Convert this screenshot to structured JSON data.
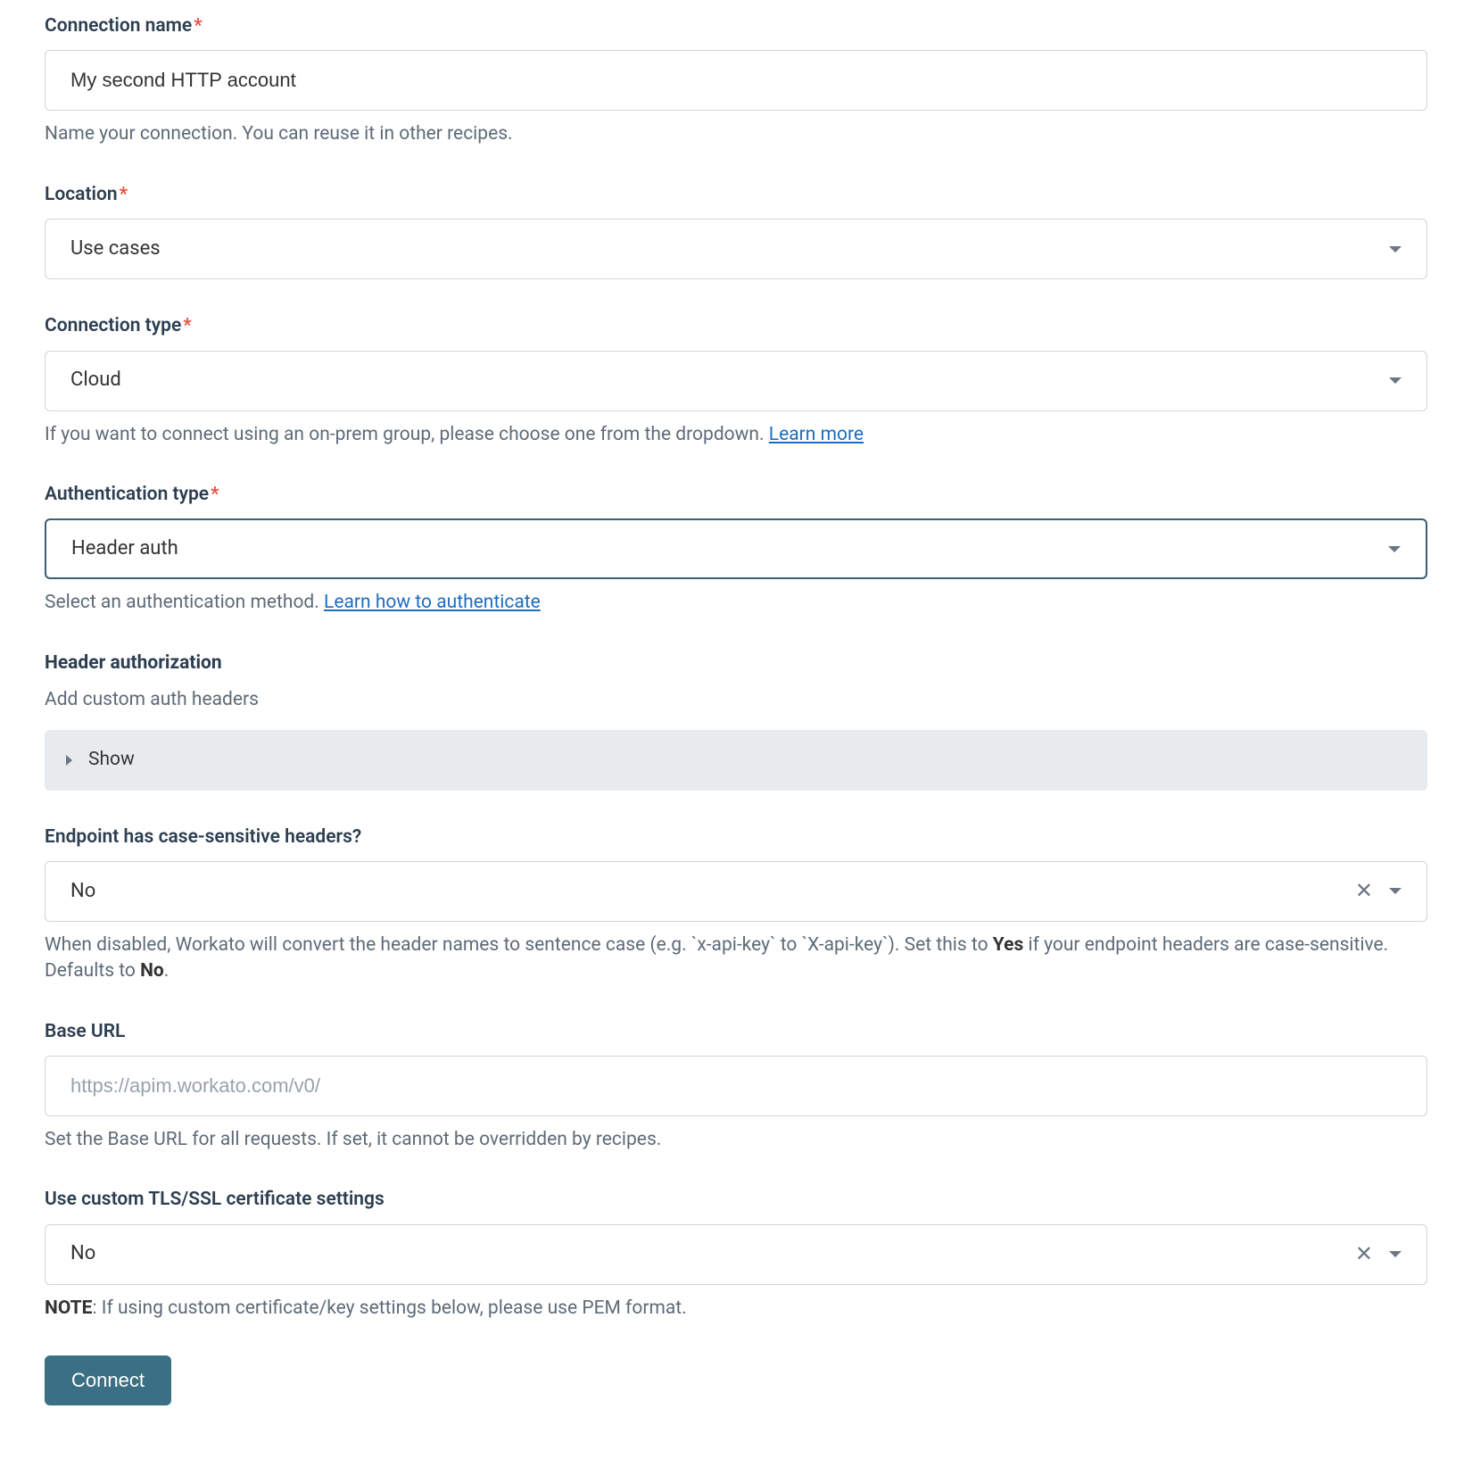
{
  "connectionName": {
    "label": "Connection name",
    "value": "My second HTTP account",
    "help": "Name your connection. You can reuse it in other recipes."
  },
  "location": {
    "label": "Location",
    "value": "Use cases"
  },
  "connectionType": {
    "label": "Connection type",
    "value": "Cloud",
    "helpPrefix": "If you want to connect using an on-prem group, please choose one from the dropdown. ",
    "learnMore": "Learn more"
  },
  "authType": {
    "label": "Authentication type",
    "value": "Header auth",
    "helpPrefix": "Select an authentication method. ",
    "learnLink": "Learn how to authenticate"
  },
  "headerAuth": {
    "title": "Header authorization",
    "subtitle": "Add custom auth headers",
    "showLabel": "Show"
  },
  "caseSensitive": {
    "label": "Endpoint has case-sensitive headers?",
    "value": "No",
    "helpPrefix": "When disabled, Workato will convert the header names to sentence case (e.g. `x-api-key` to `X-api-key`). Set this to ",
    "helpBold1": "Yes",
    "helpMid": " if your endpoint headers are case-sensitive. Defaults to ",
    "helpBold2": "No",
    "helpEnd": "."
  },
  "baseUrl": {
    "label": "Base URL",
    "placeholder": "https://apim.workato.com/v0/",
    "help": "Set the Base URL for all requests. If set, it cannot be overridden by recipes."
  },
  "tls": {
    "label": "Use custom TLS/SSL certificate settings",
    "value": "No",
    "helpBold": "NOTE",
    "helpText": ": If using custom certificate/key settings below, please use PEM format."
  },
  "connectBtn": "Connect"
}
